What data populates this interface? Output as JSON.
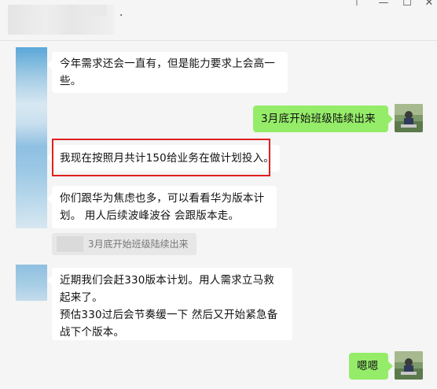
{
  "titlebar": {
    "title_suffix": "·",
    "controls": {
      "pin": "⊤",
      "minimize": "—",
      "maximize": "☐",
      "close": "✕"
    }
  },
  "messages": [
    {
      "side": "in",
      "lines": [
        "今年需求还会一直有，但是能力要求上会高一",
        "些。"
      ]
    },
    {
      "side": "out",
      "lines": [
        "3月底开始班级陆续出来"
      ]
    },
    {
      "side": "in",
      "lines": [
        "我现在按照月共计150给业务在做计划投入。"
      ]
    },
    {
      "side": "in",
      "lines": [
        "你们跟华为焦虑也多，可以看看华为版本计",
        "划。 用人后续波峰波谷 会跟版本走。"
      ]
    },
    {
      "side": "in",
      "lines": [
        "近期我们会赶330版本计划。用人需求立马救",
        "起来了。",
        " 预估330过后会节奏缓一下 然后又开始紧急备",
        "战下个版本。"
      ]
    },
    {
      "side": "out",
      "lines": [
        "嗯嗯"
      ]
    }
  ],
  "quote": {
    "text": "3月底开始班级陆续出来"
  },
  "colors": {
    "background": "#f5f5f5",
    "incoming_bubble": "#ffffff",
    "outgoing_bubble": "#95ec69",
    "highlight": "#e02020",
    "avatar_blur": "#8fbfe0"
  }
}
